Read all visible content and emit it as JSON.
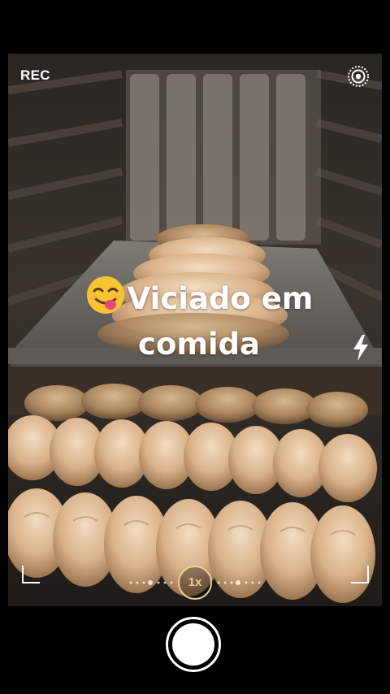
{
  "app": {
    "rec_label": "REC",
    "caption_line1": "Viciado em",
    "caption_line2": "comida",
    "caption_emoji": "face-savoring-food-emoji",
    "zoom_label": "1x"
  },
  "icons": {
    "settings": "settings-ring-icon",
    "flash": "flash-bolt-icon",
    "shutter": "shutter-button"
  },
  "colors": {
    "background": "#000000",
    "zoom_accent": "#e8d28a",
    "text": "#ffffff"
  }
}
